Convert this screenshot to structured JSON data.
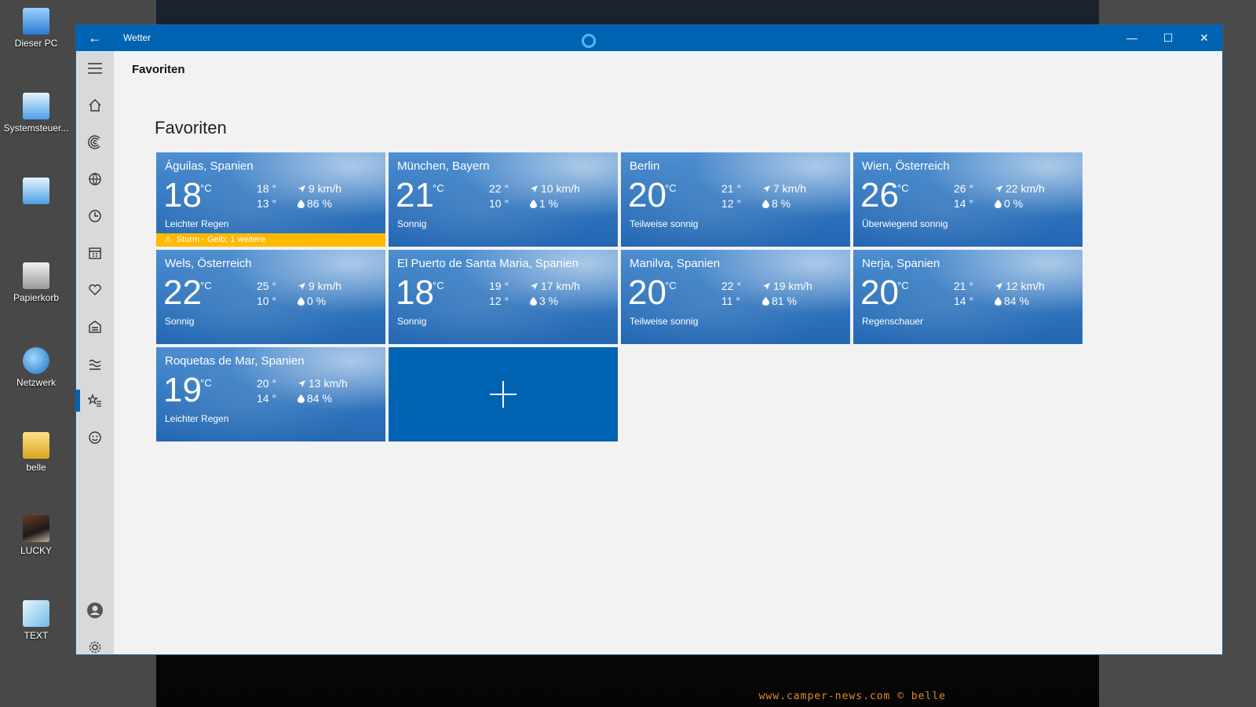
{
  "desktop": {
    "icons": [
      {
        "label": "Dieser PC"
      },
      {
        "label": "Systemsteuer..."
      },
      {
        "label": ""
      },
      {
        "label": "Papierkorb"
      },
      {
        "label": "Netzwerk"
      },
      {
        "label": "belle"
      },
      {
        "label": "LUCKY"
      },
      {
        "label": "TEXT"
      }
    ],
    "watermark": "www.camper-news.com © belle"
  },
  "window": {
    "title": "Wetter",
    "page_header": "Favoriten",
    "section_title": "Favoriten"
  },
  "colors": {
    "accent": "#0063b1",
    "alert": "#ffb900"
  },
  "nav": {
    "items": [
      "hamburger-menu-icon",
      "home-icon",
      "radar-icon",
      "globe-icon",
      "clock-icon",
      "calendar-icon",
      "heart-icon",
      "news-icon",
      "chart-icon",
      "favorites-icon",
      "smiley-icon",
      "account-icon",
      "gear-icon"
    ]
  },
  "tiles": [
    {
      "city": "Águilas, Spanien",
      "temp": "18",
      "unit": "°C",
      "hi": "18 °",
      "lo": "13 °",
      "wind": "9 km/h",
      "rain": "86 %",
      "cond": "Leichter Regen",
      "alert": "Sturm - Gelb; 1 weitere"
    },
    {
      "city": "München, Bayern",
      "temp": "21",
      "unit": "°C",
      "hi": "22 °",
      "lo": "10 °",
      "wind": "10 km/h",
      "rain": "1 %",
      "cond": "Sonnig"
    },
    {
      "city": "Berlin",
      "temp": "20",
      "unit": "°C",
      "hi": "21 °",
      "lo": "12 °",
      "wind": "7 km/h",
      "rain": "8 %",
      "cond": "Teilweise sonnig"
    },
    {
      "city": "Wien, Österreich",
      "temp": "26",
      "unit": "°C",
      "hi": "26 °",
      "lo": "14 °",
      "wind": "22 km/h",
      "rain": "0 %",
      "cond": "Überwiegend sonnig"
    },
    {
      "city": "Wels, Österreich",
      "temp": "22",
      "unit": "°C",
      "hi": "25 °",
      "lo": "10 °",
      "wind": "9 km/h",
      "rain": "0 %",
      "cond": "Sonnig"
    },
    {
      "city": "El Puerto de Santa Maria, Spanien",
      "temp": "18",
      "unit": "°C",
      "hi": "19 °",
      "lo": "12 °",
      "wind": "17 km/h",
      "rain": "3 %",
      "cond": "Sonnig"
    },
    {
      "city": "Manilva, Spanien",
      "temp": "20",
      "unit": "°C",
      "hi": "22 °",
      "lo": "11 °",
      "wind": "19 km/h",
      "rain": "81 %",
      "cond": "Teilweise sonnig"
    },
    {
      "city": "Nerja, Spanien",
      "temp": "20",
      "unit": "°C",
      "hi": "21 °",
      "lo": "14 °",
      "wind": "12 km/h",
      "rain": "84 %",
      "cond": "Regenschauer"
    },
    {
      "city": "Roquetas de Mar, Spanien",
      "temp": "19",
      "unit": "°C",
      "hi": "20 °",
      "lo": "14 °",
      "wind": "13 km/h",
      "rain": "84 %",
      "cond": "Leichter Regen"
    }
  ]
}
